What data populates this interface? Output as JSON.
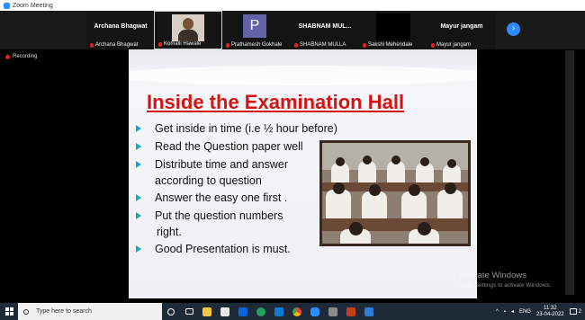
{
  "window": {
    "title": "Zoom Meeting"
  },
  "participants": [
    {
      "big_name": "Archana Bhagwat",
      "label": "Archana Bhagwat"
    },
    {
      "big_name": "",
      "label": "Komalli Hawale"
    },
    {
      "big_name": "P",
      "label": "Prathamesh Gokhale"
    },
    {
      "big_name": "SHABNAM  MUL...",
      "label": "SHABNAM MULLA"
    },
    {
      "big_name": "",
      "label": "Sakshi Mehendale"
    },
    {
      "big_name": "Mayur jangam",
      "label": "Mayur jangam"
    }
  ],
  "recording": {
    "label": "Recording"
  },
  "slide": {
    "title": "Inside the Examination Hall",
    "bullets": [
      " Get inside in time (i.e ½ hour before)",
      "Read the Question paper  well",
      "Distribute time and answer",
      "Answer the easy one first .",
      "Put the question numbers",
      "Good Presentation is must."
    ],
    "continuations": [
      "according to question",
      "right."
    ]
  },
  "watermark": {
    "title": "Activate Windows",
    "subtitle": "Go to Settings to activate Windows."
  },
  "taskbar": {
    "search_placeholder": "Type here to search",
    "language": "ENG",
    "time": "11:32",
    "date": "23-04-2022",
    "notification_count": "2"
  }
}
